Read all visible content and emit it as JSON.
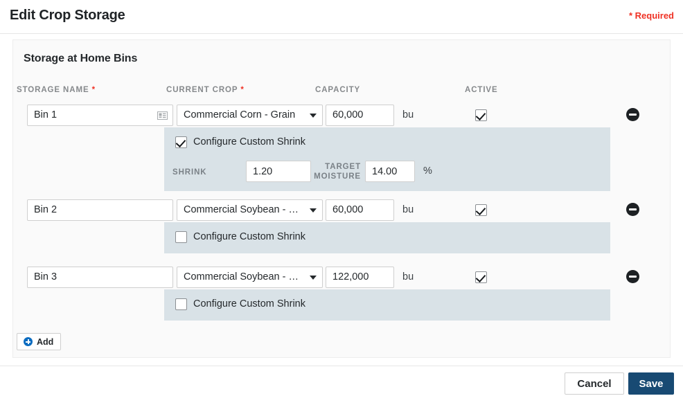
{
  "header": {
    "title": "Edit Crop Storage",
    "required_note": "* Required"
  },
  "card": {
    "title": "Storage at Home Bins",
    "columns": {
      "storage_name": "STORAGE NAME",
      "storage_name_required": "*",
      "current_crop": "CURRENT CROP",
      "current_crop_required": "*",
      "capacity": "CAPACITY",
      "active": "ACTIVE"
    },
    "unit_label": "bu",
    "shrink": {
      "toggle_label": "Configure Custom Shrink",
      "shrink_label": "SHRINK",
      "target_moisture_label_line1": "TARGET",
      "target_moisture_label_line2": "MOISTURE",
      "percent_label": "%"
    },
    "add_button": {
      "label": "Add",
      "icon": "plus-circle-icon"
    },
    "rows": [
      {
        "name": "Bin 1",
        "name_icon": "contact-card-icon",
        "crop": "Commercial Corn - Grain",
        "capacity": "60,000",
        "active": true,
        "configure_custom_shrink": true,
        "shrink_value": "1.20",
        "target_moisture_value": "14.00"
      },
      {
        "name": "Bin 2",
        "crop": "Commercial Soybean - Gr...",
        "capacity": "60,000",
        "active": true,
        "configure_custom_shrink": false
      },
      {
        "name": "Bin 3",
        "crop": "Commercial Soybean - Gr...",
        "capacity": "122,000",
        "active": true,
        "configure_custom_shrink": false
      }
    ]
  },
  "footer": {
    "cancel_label": "Cancel",
    "save_label": "Save"
  },
  "colors": {
    "required_red": "#ef3124",
    "save_navy": "#184a73",
    "add_blue": "#0b6cc0",
    "shrink_panel": "#d9e2e7",
    "card_bg": "#fafafa"
  }
}
